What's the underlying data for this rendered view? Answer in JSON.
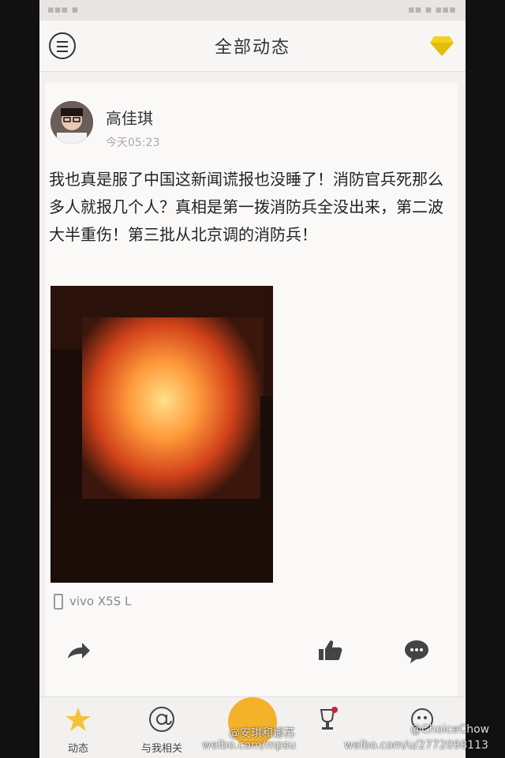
{
  "header": {
    "title": "全部动态"
  },
  "post": {
    "username": "高佳琪",
    "timestamp": "今天05:23",
    "text": "我也真是服了中国这新闻谎报也没睡了！消防官兵死那么多人就报几个人？真相是第一拨消防兵全没出来，第二波大半重伤！第三批从北京调的消防兵！",
    "device": "vivo X5S L"
  },
  "tabs": [
    {
      "label": "动态"
    },
    {
      "label": "与我相关"
    },
    {
      "label": ""
    },
    {
      "label": ""
    },
    {
      "label": ""
    }
  ],
  "watermarks": {
    "w1_handle": "@安琪和娜苏",
    "w1_url": "weibo.com/mpsu",
    "w2_handle": "@ChoiceChow",
    "w2_url": "weibo.com/u/2772098113"
  },
  "colors": {
    "accent": "#f4b12a",
    "gem": "#f5d020"
  },
  "icons": {
    "menu": "menu-icon",
    "gem": "gem-icon",
    "share": "share-icon",
    "like": "thumbs-up-icon",
    "comment": "comment-icon",
    "tab_dynamic": "star-icon",
    "tab_mentions": "at-icon"
  }
}
